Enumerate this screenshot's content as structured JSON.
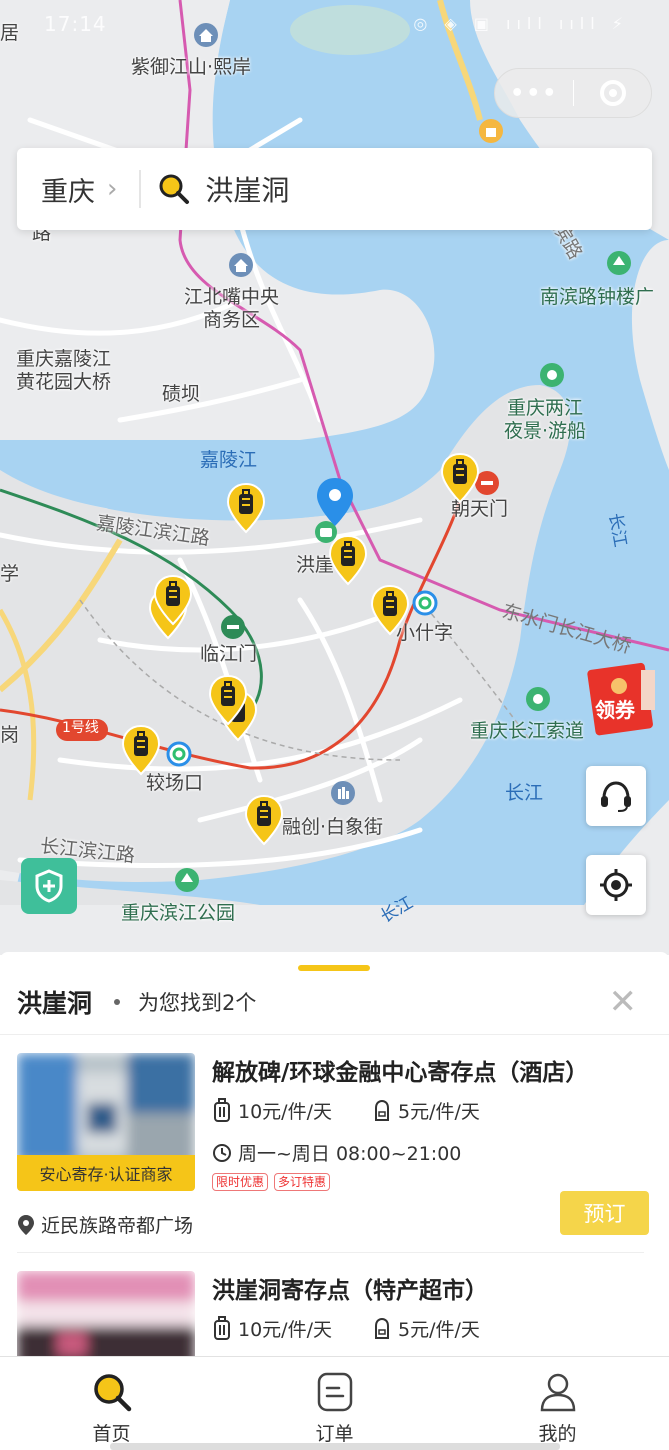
{
  "status_bar": {
    "time": "17:14",
    "icons": "◎ ◈ ▣ ııll ııll ⚡"
  },
  "capsule": {
    "more": "•••",
    "close": "target-icon"
  },
  "search": {
    "city": "重庆",
    "chevron": "›",
    "keyword": "洪崖洞"
  },
  "map": {
    "labels": {
      "zi_yu": "紫御江山·熙岸",
      "jiangbei": "江北嘴中央\n商务区",
      "jialing_bridge": "重庆嘉陵江\n黄花园大桥",
      "qi_ba": "碛坝",
      "jialing_river": "嘉陵江",
      "jialing_road": "嘉陵江滨江路",
      "hongya": "洪崖",
      "chaotian": "朝天门",
      "xiao_shizi": "小什字",
      "linjiang": "临江门",
      "jiaochang": "较场口",
      "rongchuang": "融创·白象街",
      "changjiang_road": "长江滨江路",
      "binjiang_park": "重庆滨江公园",
      "nanbin": "南滨路钟楼广",
      "liangjiang": "重庆两江\n夜景·游船",
      "suodao": "重庆长江索道",
      "dongshui": "东水门长江大桥",
      "changjiang1": "长江",
      "changjiang2": "长江",
      "changjiang3": "长江",
      "line1": "1号线",
      "edge_ju": "居",
      "edge_lu": "路",
      "edge_xue": "学",
      "edge_gang": "岗",
      "nanbin_road": "滨路"
    }
  },
  "coupon": {
    "label": "领券"
  },
  "results": {
    "title": "洪崖洞",
    "count_text": "为您找到2个",
    "close": "✕",
    "stores": [
      {
        "name": "解放碑/环球金融中心寄存点（酒店）",
        "price_large": "10元/件/天",
        "price_small": "5元/件/天",
        "hours": "周一~周日 08:00~21:00",
        "tags": [
          "限时优惠",
          "多订特惠"
        ],
        "badge": "安心寄存·认证商家",
        "address": "近民族路帝都广场",
        "book": "预订"
      },
      {
        "name": "洪崖洞寄存点（特产超市）",
        "price_large": "10元/件/天",
        "price_small": "5元/件/天"
      }
    ]
  },
  "tabbar": {
    "tabs": [
      {
        "label": "首页",
        "icon": "search-icon"
      },
      {
        "label": "订单",
        "icon": "order-icon"
      },
      {
        "label": "我的",
        "icon": "profile-icon"
      }
    ]
  },
  "colors": {
    "accent": "#f5c518",
    "water": "#a8d3f2",
    "metro_red": "#e2472f",
    "metro_green": "#2e8b57",
    "road_pink": "#d65ab0",
    "pin_blue": "#2a8fe8"
  }
}
